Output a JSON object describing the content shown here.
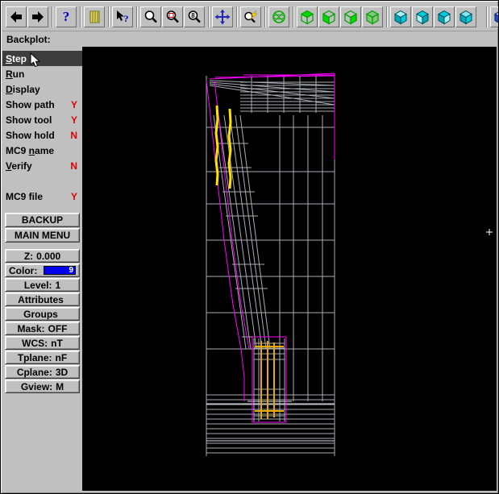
{
  "prompt": {
    "label": "Backplot:"
  },
  "toolbar": {
    "icons": [
      {
        "name": "back-icon"
      },
      {
        "name": "forward-icon"
      },
      {
        "name": "help-icon"
      },
      {
        "name": "operations-list-icon"
      },
      {
        "name": "context-help-icon"
      },
      {
        "name": "zoom-icon"
      },
      {
        "name": "zoom-window-icon"
      },
      {
        "name": "zoom-previous-icon"
      },
      {
        "name": "fit-screen-icon"
      },
      {
        "name": "repaint-icon"
      },
      {
        "name": "dynamic-rotate-icon"
      },
      {
        "name": "gview-top-cube-icon"
      },
      {
        "name": "gview-front-cube-icon"
      },
      {
        "name": "gview-side-cube-icon"
      },
      {
        "name": "gview-isometric-cube-icon"
      },
      {
        "name": "cplane-cube-1-icon"
      },
      {
        "name": "cplane-cube-2-icon"
      },
      {
        "name": "cplane-cube-3-icon"
      },
      {
        "name": "cplane-cube-4-icon"
      },
      {
        "name": "screen-view-cube-icon"
      }
    ]
  },
  "sidebar": {
    "value_color": "#dd0000",
    "menu": [
      {
        "label": "Step",
        "accel": 0,
        "value": "",
        "selected": true
      },
      {
        "label": "Run",
        "accel": 0,
        "value": ""
      },
      {
        "label": "Display",
        "accel": 0,
        "value": ""
      },
      {
        "label": "Show path",
        "accel": -1,
        "value": "Y"
      },
      {
        "label": "Show tool",
        "accel": -1,
        "value": "Y"
      },
      {
        "label": "Show hold",
        "accel": -1,
        "value": "N"
      },
      {
        "label": "MC9 name",
        "accel": 4,
        "value": ""
      },
      {
        "label": "Verify",
        "accel": 0,
        "value": "N"
      },
      {
        "label": "MC9 file",
        "accel": -1,
        "value": "Y"
      }
    ],
    "buttons": [
      {
        "label": "BACKUP"
      },
      {
        "label": "MAIN MENU"
      }
    ],
    "status": [
      {
        "label": "Z:",
        "value": "0.000"
      },
      {
        "label": "Color:",
        "value": "9",
        "swatch": "#0000ee"
      },
      {
        "label": "Level:",
        "value": "1"
      },
      {
        "label": "Attributes",
        "value": ""
      },
      {
        "label": "Groups",
        "value": ""
      },
      {
        "label": "Mask:",
        "value": "OFF"
      },
      {
        "label": "WCS:",
        "value": "nT"
      },
      {
        "label": "Tplane:",
        "value": "nF"
      },
      {
        "label": "Cplane:",
        "value": "3D"
      },
      {
        "label": "Gview:",
        "value": "M"
      }
    ]
  },
  "viewport": {
    "bg": "#000000"
  }
}
